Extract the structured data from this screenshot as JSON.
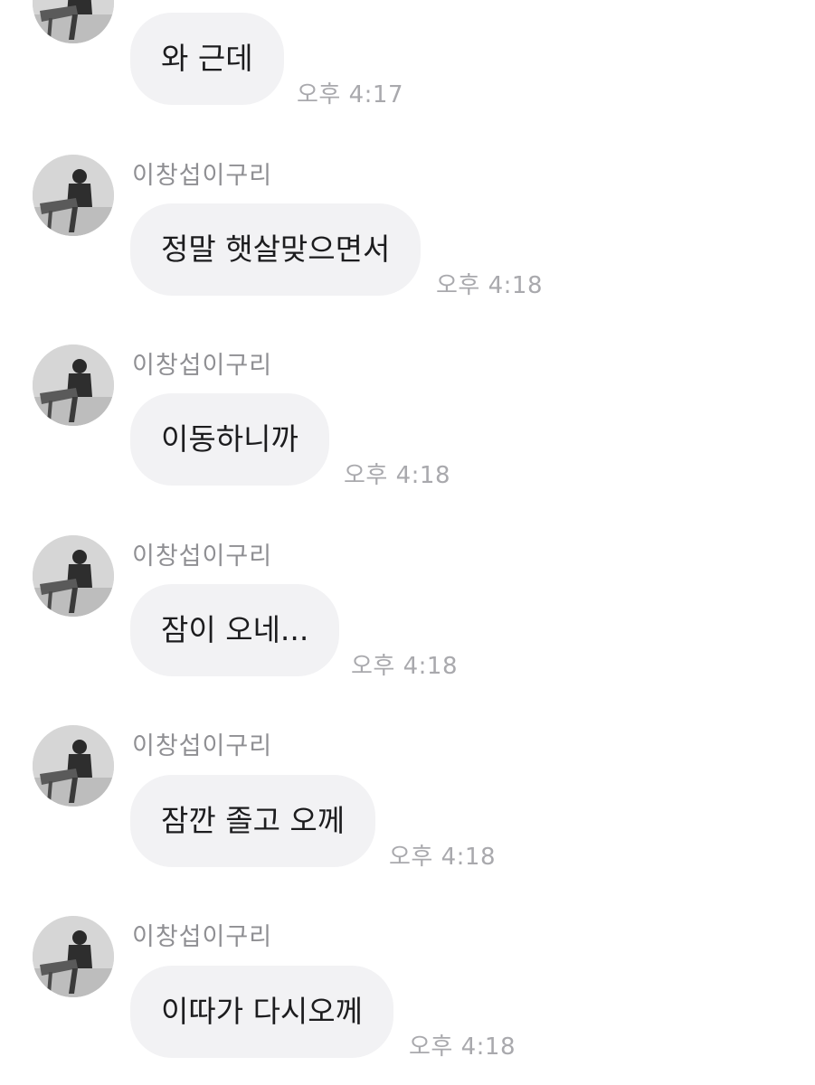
{
  "messages": [
    {
      "sender": "",
      "text": "와 근데",
      "time": "오후 4:17"
    },
    {
      "sender": "이창섭이구리",
      "text": "정말 햇살맞으면서",
      "time": "오후 4:18"
    },
    {
      "sender": "이창섭이구리",
      "text": "이동하니까",
      "time": "오후 4:18"
    },
    {
      "sender": "이창섭이구리",
      "text": "잠이 오네...",
      "time": "오후 4:18"
    },
    {
      "sender": "이창섭이구리",
      "text": "잠깐 졸고 오께",
      "time": "오후 4:18"
    },
    {
      "sender": "이창섭이구리",
      "text": "이따가 다시오께",
      "time": "오후 4:18"
    }
  ],
  "colors": {
    "bubble": "#f2f2f4",
    "text": "#1c1c1e",
    "sender": "#8f8f93",
    "time": "#a9a9ad"
  },
  "icons": {
    "avatar": "profile-photo-avatar"
  }
}
